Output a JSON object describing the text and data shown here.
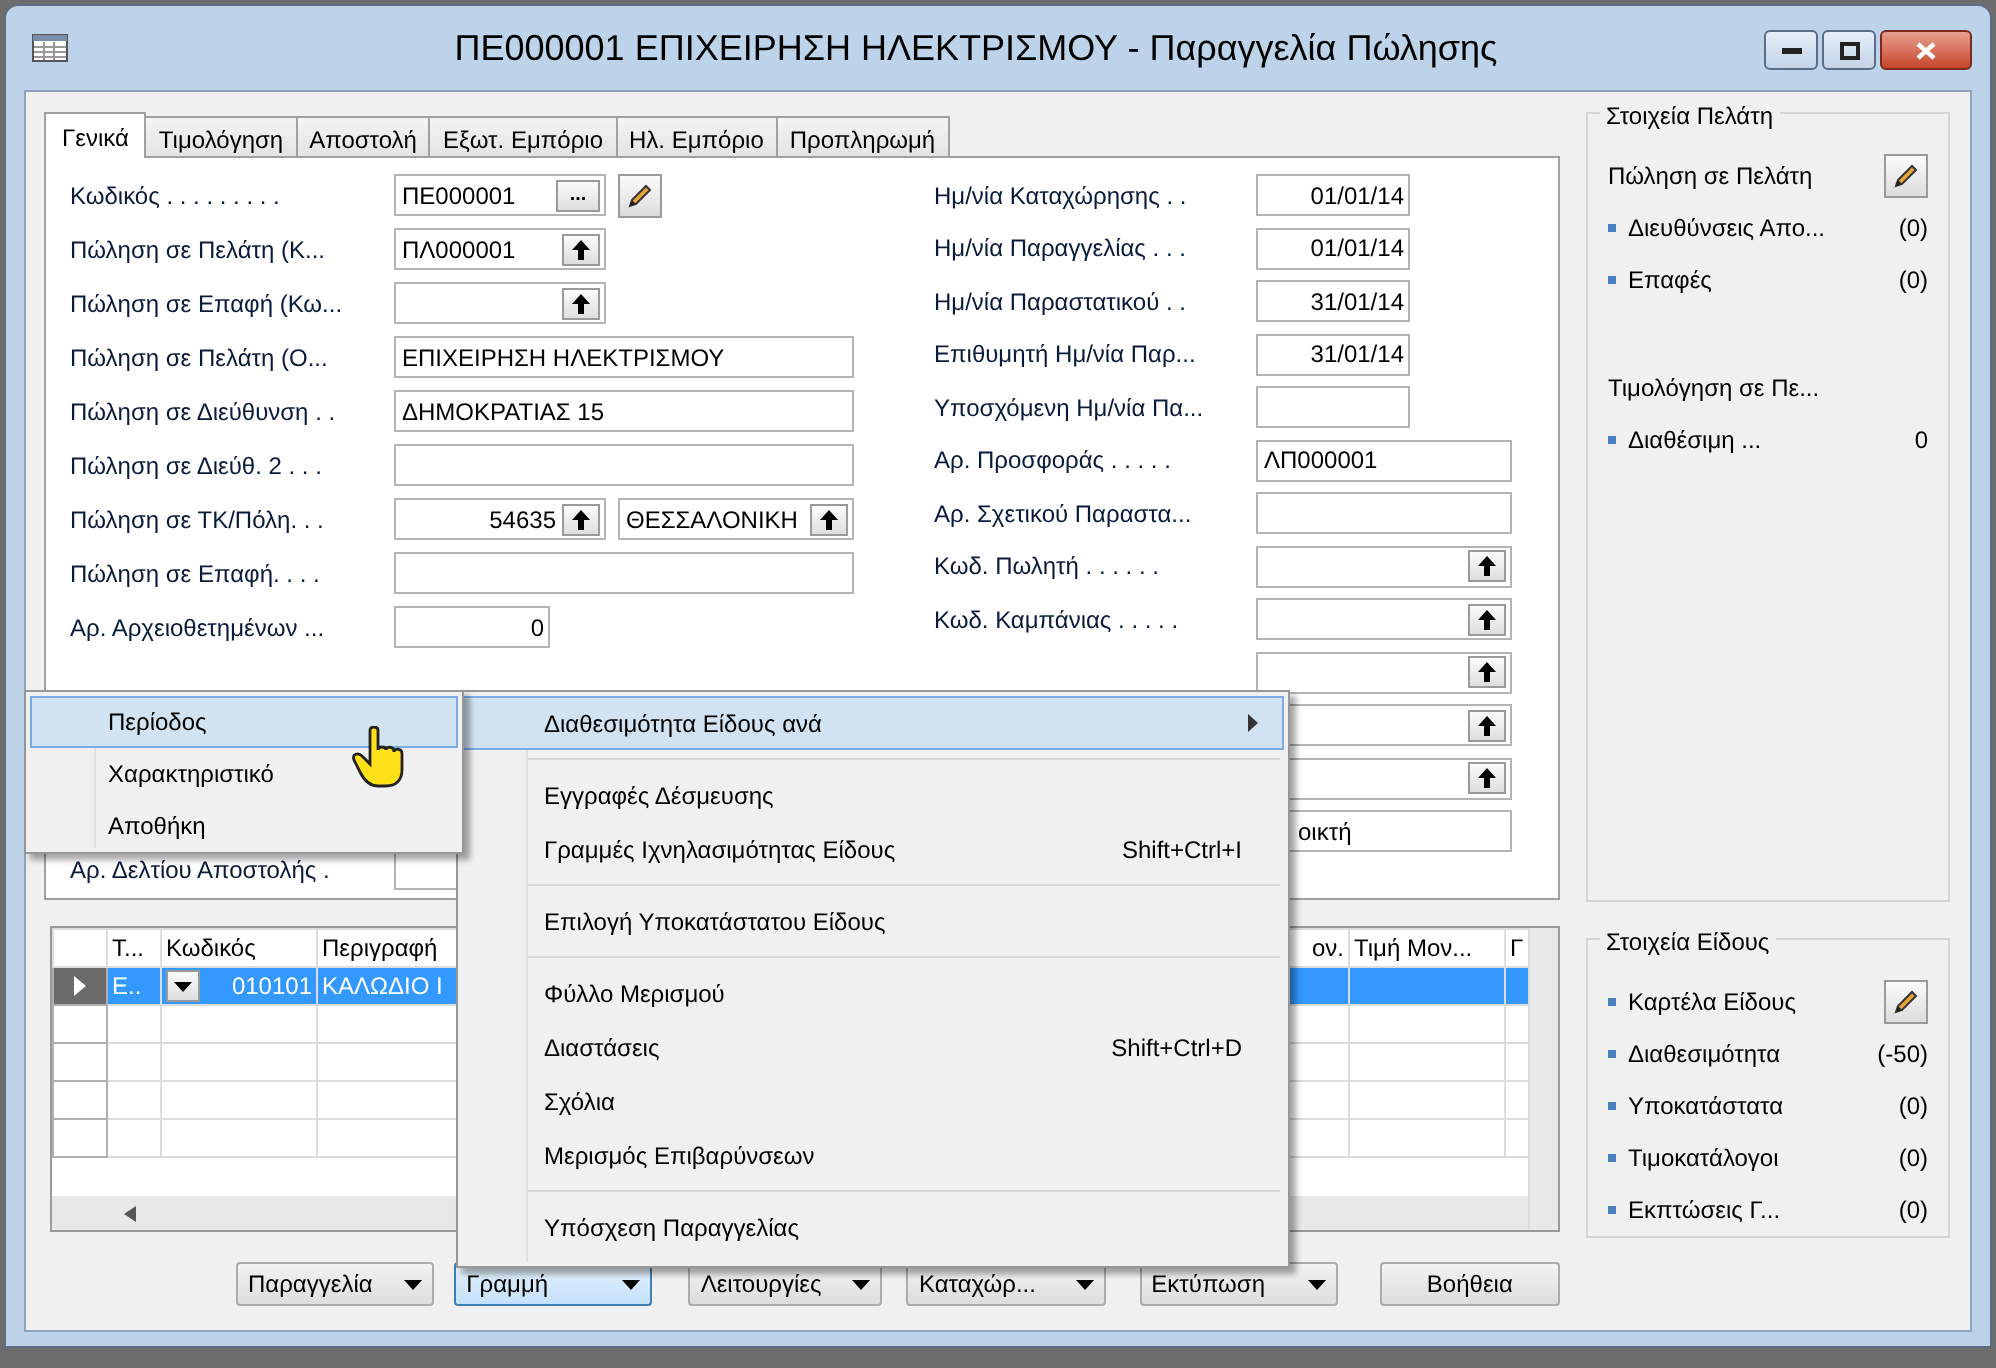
{
  "window": {
    "title": "ΠΕ000001 ΕΠΙΧΕΙΡΗΣΗ ΗΛΕΚΤΡΙΣΜΟΥ - Παραγγελία Πώλησης"
  },
  "tabs": [
    {
      "label": "Γενικά",
      "selected": true
    },
    {
      "label": "Τιμολόγηση",
      "selected": false
    },
    {
      "label": "Αποστολή",
      "selected": false
    },
    {
      "label": "Εξωτ. Εμπόριο",
      "selected": false
    },
    {
      "label": "Ηλ. Εμπόριο",
      "selected": false
    },
    {
      "label": "Προπληρωμή",
      "selected": false
    }
  ],
  "general_left": [
    {
      "kind": "code",
      "label": "Κωδικός . . . . . . . . .",
      "value": "ΠΕ000001",
      "assist_button": "..."
    },
    {
      "kind": "lookup",
      "label": "Πώληση σε Πελάτη (Κ...",
      "value": "ΠΛ000001"
    },
    {
      "kind": "lookup",
      "label": "Πώληση σε Επαφή (Κω..."
    },
    {
      "kind": "text",
      "label": "Πώληση σε Πελάτη (Ο...",
      "value": "ΕΠΙΧΕΙΡΗΣΗ ΗΛΕΚΤΡΙΣΜΟΥ"
    },
    {
      "kind": "text",
      "label": "Πώληση σε Διεύθυνση . .",
      "value": "ΔΗΜΟΚΡΑΤΙΑΣ 15"
    },
    {
      "kind": "text",
      "label": "Πώληση σε Διεύθ. 2 . . ."
    },
    {
      "kind": "postcode",
      "label": "Πώληση σε ΤΚ/Πόλη. . .",
      "value": "54635",
      "city": "ΘΕΣΣΑΛΟΝΙΚΗ"
    },
    {
      "kind": "text",
      "label": "Πώληση σε Επαφή. . . ."
    },
    {
      "kind": "number",
      "label": "Αρ. Αρχειοθετημένων ...",
      "value": "0"
    },
    {
      "kind": "number",
      "label": "Αρ. Δελτίου Αποστολής ."
    }
  ],
  "general_right": [
    {
      "kind": "date",
      "label": "Ημ/νία Καταχώρησης . .",
      "value": "01/01/14"
    },
    {
      "kind": "date",
      "label": "Ημ/νία Παραγγελίας . . .",
      "value": "01/01/14"
    },
    {
      "kind": "date",
      "label": "Ημ/νία Παραστατικού . .",
      "value": "31/01/14"
    },
    {
      "kind": "date",
      "label": "Επιθυμητή Ημ/νία Παρ...",
      "value": "31/01/14"
    },
    {
      "kind": "date",
      "label": "Υποσχόμενη Ημ/νία Πα..."
    },
    {
      "kind": "text",
      "label": "Αρ. Προσφοράς . . . . .",
      "value": "ΛΠ000001"
    },
    {
      "kind": "text",
      "label": "Αρ. Σχετικού Παραστα..."
    },
    {
      "kind": "lookup",
      "label": "Κωδ. Πωλητή . . . . . ."
    },
    {
      "kind": "lookup",
      "label": "Κωδ. Καμπάνιας . . . . ."
    },
    {
      "kind": "lookup"
    },
    {
      "kind": "lookup"
    },
    {
      "kind": "lookup"
    },
    {
      "kind": "text",
      "value": "οικτή"
    }
  ],
  "lines_table": {
    "columns": [
      "Τ...",
      "Κωδικός",
      "Περιγραφή",
      "ον.",
      "Τιμή Μον...",
      "Γ"
    ],
    "rows": [
      {
        "selected": true,
        "cells": [
          "Ε..",
          "010101",
          "ΚΑΛΩΔΙΟ Ι"
        ]
      }
    ]
  },
  "action_buttons": [
    {
      "label": "Παραγγελία",
      "dropdown": true,
      "pressed": false
    },
    {
      "label": "Γραμμή",
      "dropdown": true,
      "pressed": true
    },
    {
      "label": "Λειτουργίες",
      "dropdown": true,
      "pressed": false
    },
    {
      "label": "Καταχώρ...",
      "dropdown": true,
      "pressed": false
    },
    {
      "label": "Εκτύπωση",
      "dropdown": true,
      "pressed": false
    },
    {
      "label": "Βοήθεια",
      "dropdown": false,
      "pressed": false
    }
  ],
  "customer_panel": {
    "title": "Στοιχεία Πελάτη",
    "items": [
      {
        "kind": "heading_edit",
        "label": "Πώληση σε Πελάτη"
      },
      {
        "kind": "link",
        "label": "Διευθύνσεις Απο...",
        "count": "(0)"
      },
      {
        "kind": "link",
        "label": "Επαφές",
        "count": "(0)"
      },
      {
        "kind": "heading",
        "label": "Τιμολόγηση σε Πε..."
      },
      {
        "kind": "link",
        "label": "Διαθέσιμη ...",
        "count": "0"
      }
    ]
  },
  "item_panel": {
    "title": "Στοιχεία Είδους",
    "items": [
      {
        "kind": "link_edit",
        "label": "Καρτέλα Είδους"
      },
      {
        "kind": "link",
        "label": "Διαθεσιμότητα",
        "count": "(-50)"
      },
      {
        "kind": "link",
        "label": "Υποκατάστατα",
        "count": "(0)"
      },
      {
        "kind": "link",
        "label": "Τιμοκατάλογοι",
        "count": "(0)"
      },
      {
        "kind": "link",
        "label": "Εκπτώσεις Γ...",
        "count": "(0)"
      }
    ]
  },
  "context_menu": {
    "items": [
      {
        "kind": "item",
        "label": "Διαθεσιμότητα Είδους ανά",
        "submenu": true,
        "selected": true
      },
      {
        "kind": "separator"
      },
      {
        "kind": "item",
        "label": "Εγγραφές Δέσμευσης",
        "selected": false
      },
      {
        "kind": "item",
        "label": "Γραμμές Ιχνηλασιμότητας Είδους",
        "shortcut": "Shift+Ctrl+I",
        "selected": false
      },
      {
        "kind": "separator"
      },
      {
        "kind": "item",
        "label": "Επιλογή Υποκατάστατου Είδους",
        "selected": false
      },
      {
        "kind": "separator"
      },
      {
        "kind": "item",
        "label": "Φύλλο Μερισμού",
        "selected": false
      },
      {
        "kind": "item",
        "label": "Διαστάσεις",
        "shortcut": "Shift+Ctrl+D",
        "selected": false
      },
      {
        "kind": "item",
        "label": "Σχόλια",
        "selected": false
      },
      {
        "kind": "item",
        "label": "Μερισμός Επιβαρύνσεων",
        "selected": false
      },
      {
        "kind": "separator"
      },
      {
        "kind": "item",
        "label": "Υπόσχεση Παραγγελίας",
        "selected": false
      }
    ]
  },
  "submenu": {
    "items": [
      {
        "label": "Περίοδος",
        "selected": true
      },
      {
        "label": "Χαρακτηριστικό",
        "selected": false
      },
      {
        "label": "Αποθήκη",
        "selected": false
      }
    ]
  }
}
